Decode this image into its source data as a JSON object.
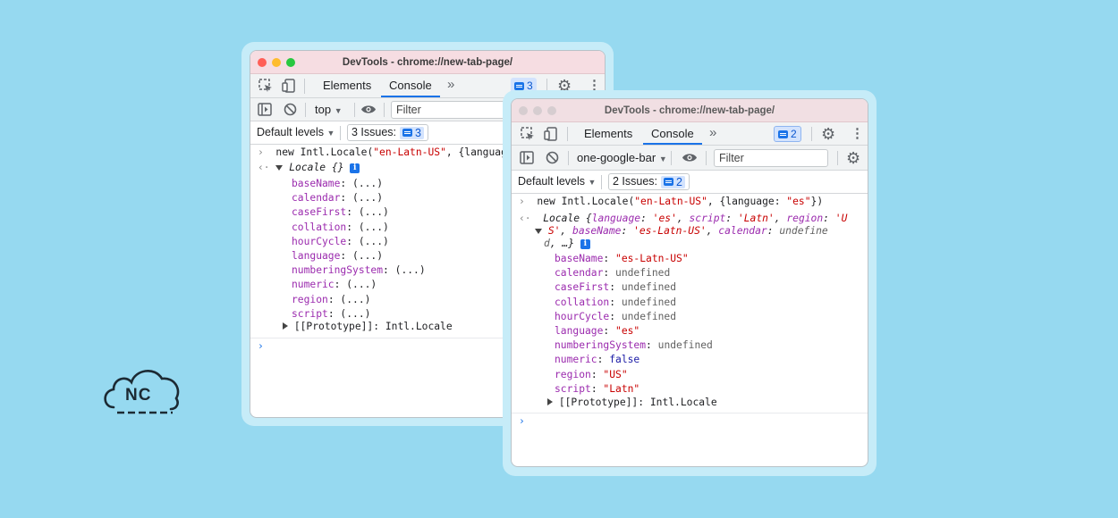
{
  "colors": {
    "background": "#96d9f0",
    "accent": "#1a73e8",
    "arrow": "#1f7ff0"
  },
  "back_window": {
    "title": "DevTools - chrome://new-tab-page/",
    "tabs": [
      "Elements",
      "Console"
    ],
    "more_tabs": "»",
    "message_count": "3",
    "context": "top",
    "filter_placeholder": "Filter",
    "levels": "Default levels",
    "issues_label": "3 Issues:",
    "issues_count": "3",
    "command": {
      "pre": "new Intl.Locale(",
      "arg": "\"en-Latn-US\"",
      "post": ", {language:"
    },
    "result_label": "Locale {}",
    "props": [
      {
        "name": "baseName",
        "value": "(...)"
      },
      {
        "name": "calendar",
        "value": "(...)"
      },
      {
        "name": "caseFirst",
        "value": "(...)"
      },
      {
        "name": "collation",
        "value": "(...)"
      },
      {
        "name": "hourCycle",
        "value": "(...)"
      },
      {
        "name": "language",
        "value": "(...)"
      },
      {
        "name": "numberingSystem",
        "value": "(...)"
      },
      {
        "name": "numeric",
        "value": "(...)"
      },
      {
        "name": "region",
        "value": "(...)"
      },
      {
        "name": "script",
        "value": "(...)"
      }
    ],
    "prototype": "[[Prototype]]",
    "prototype_value": "Intl.Locale"
  },
  "front_window": {
    "title": "DevTools - chrome://new-tab-page/",
    "tabs": [
      "Elements",
      "Console"
    ],
    "more_tabs": "»",
    "message_count": "2",
    "context": "one-google-bar",
    "filter_placeholder": "Filter",
    "levels": "Default levels",
    "issues_label": "2 Issues:",
    "issues_count": "2",
    "command": {
      "pre": "new Intl.Locale(",
      "arg1": "\"en-Latn-US\"",
      "mid": ", {language: ",
      "arg2": "\"es\"",
      "post": "})"
    },
    "preview": {
      "l1_a": "Locale {",
      "l1_b": "language",
      "l1_c": ": ",
      "l1_d": "'es'",
      "l1_e": ", ",
      "l1_f": "script",
      "l1_g": ": ",
      "l1_h": "'Latn'",
      "l1_i": ", ",
      "l1_j": "region",
      "l1_k": ": ",
      "l1_l": "'U",
      "l2_a": "S'",
      "l2_b": ", ",
      "l2_c": "baseName",
      "l2_d": ": ",
      "l2_e": "'es-Latn-US'",
      "l2_f": ", ",
      "l2_g": "calendar",
      "l2_h": ": ",
      "l2_i": "undefine",
      "l3_a": "d",
      "l3_b": ", …}"
    },
    "props": [
      {
        "name": "baseName",
        "value": "\"es-Latn-US\"",
        "kind": "k"
      },
      {
        "name": "calendar",
        "value": "undefined",
        "kind": "u"
      },
      {
        "name": "caseFirst",
        "value": "undefined",
        "kind": "u"
      },
      {
        "name": "collation",
        "value": "undefined",
        "kind": "u"
      },
      {
        "name": "hourCycle",
        "value": "undefined",
        "kind": "u"
      },
      {
        "name": "language",
        "value": "\"es\"",
        "kind": "k"
      },
      {
        "name": "numberingSystem",
        "value": "undefined",
        "kind": "u"
      },
      {
        "name": "numeric",
        "value": "false",
        "kind": "b"
      },
      {
        "name": "region",
        "value": "\"US\"",
        "kind": "k"
      },
      {
        "name": "script",
        "value": "\"Latn\"",
        "kind": "k"
      }
    ],
    "prototype": "[[Prototype]]",
    "prototype_value": "Intl.Locale"
  },
  "logo": {
    "text": "NC"
  }
}
